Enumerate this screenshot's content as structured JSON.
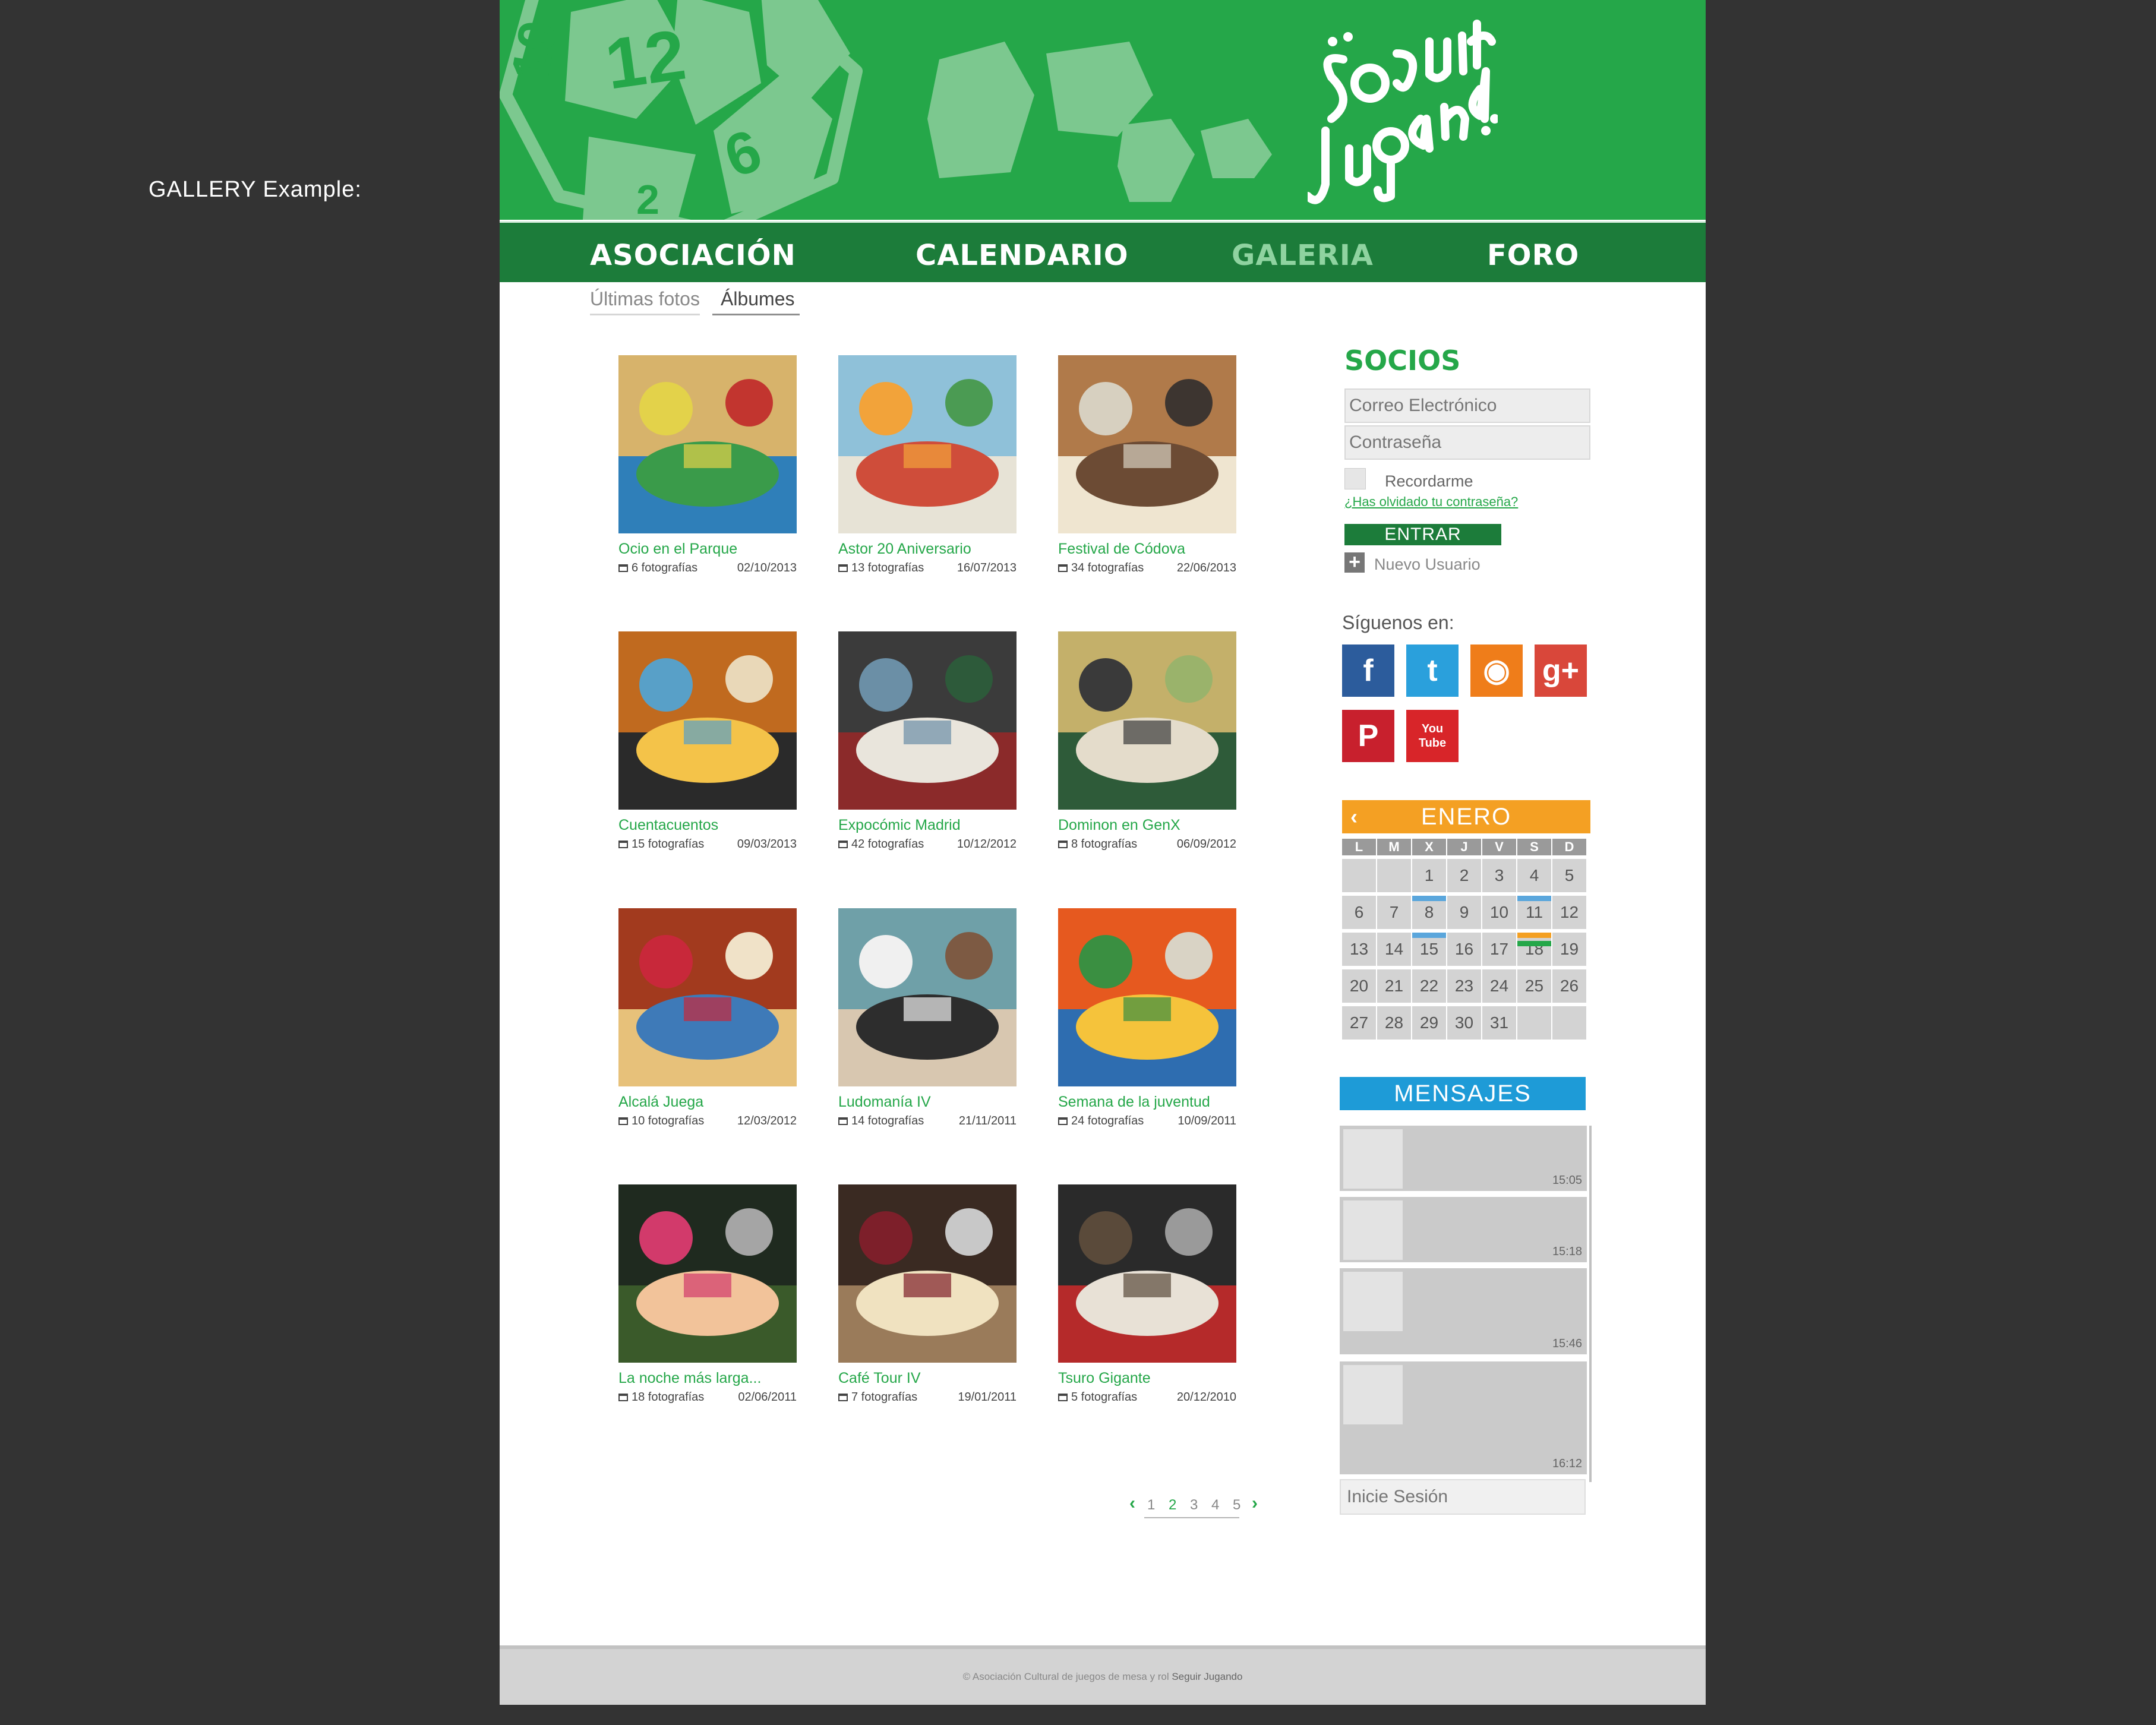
{
  "side_label": "GALLERY Example:",
  "header": {
    "logo_top": "Seguir",
    "logo_bottom": "Jugando"
  },
  "nav": [
    {
      "label": "ASOCIACIÓN",
      "active": false
    },
    {
      "label": "CALENDARIO",
      "active": false
    },
    {
      "label": "GALERIA",
      "active": true
    },
    {
      "label": "FORO",
      "active": false
    }
  ],
  "subtabs": [
    {
      "label": "Últimas fotos",
      "active": false
    },
    {
      "label": "Álbumes",
      "active": true
    }
  ],
  "albums": [
    {
      "title": "Ocio en el Parque",
      "count": "6 fotografías",
      "date": "02/10/2013"
    },
    {
      "title": "Astor 20 Aniversario",
      "count": "13 fotografías",
      "date": "16/07/2013"
    },
    {
      "title": "Festival de Códova",
      "count": "34 fotografías",
      "date": "22/06/2013"
    },
    {
      "title": "Cuentacuentos",
      "count": "15 fotografías",
      "date": "09/03/2013"
    },
    {
      "title": "Expocómic Madrid",
      "count": "42 fotografías",
      "date": "10/12/2012"
    },
    {
      "title": "Dominon en GenX",
      "count": "8 fotografías",
      "date": "06/09/2012"
    },
    {
      "title": "Alcalá Juega",
      "count": "10 fotografías",
      "date": "12/03/2012"
    },
    {
      "title": "Ludomanía IV",
      "count": "14 fotografías",
      "date": "21/11/2011"
    },
    {
      "title": "Semana de la juventud",
      "count": "24 fotografías",
      "date": "10/09/2011"
    },
    {
      "title": "La noche más larga...",
      "count": "18 fotografías",
      "date": "02/06/2011"
    },
    {
      "title": "Café Tour IV",
      "count": "7 fotografías",
      "date": "19/01/2011"
    },
    {
      "title": "Tsuro Gigante",
      "count": "5 fotografías",
      "date": "20/12/2010"
    }
  ],
  "pagination": {
    "pages": [
      "1",
      "2",
      "3",
      "4",
      "5"
    ],
    "current": "2",
    "prev": "‹",
    "next": "›"
  },
  "socios": {
    "title": "SOCIOS",
    "email_placeholder": "Correo Electrónico",
    "password_placeholder": "Contraseña",
    "remember_label": "Recordarme",
    "forgot_link": "¿Has olvidado tu contraseña?",
    "submit_label": "ENTRAR",
    "new_user_label": "Nuevo Usuario"
  },
  "follow": {
    "title": "Síguenos en:",
    "networks": [
      {
        "name": "facebook",
        "glyph": "f",
        "color": "#2c5c9c"
      },
      {
        "name": "twitter",
        "glyph": "t",
        "color": "#2aa0dc"
      },
      {
        "name": "rss",
        "glyph": "◉",
        "color": "#ef7d1a"
      },
      {
        "name": "google-plus",
        "glyph": "g+",
        "color": "#d9473a"
      },
      {
        "name": "pinterest",
        "glyph": "P",
        "color": "#c8202d"
      },
      {
        "name": "youtube",
        "glyph": "You Tube",
        "color": "#d82529"
      }
    ]
  },
  "calendar": {
    "month": "ENERO",
    "weekdays": [
      "L",
      "M",
      "X",
      "J",
      "V",
      "S",
      "D"
    ],
    "weeks": [
      [
        "",
        "",
        "1",
        "2",
        "3",
        "4",
        "5"
      ],
      [
        "6",
        "7",
        "8",
        "9",
        "10",
        "11",
        "12"
      ],
      [
        "13",
        "14",
        "15",
        "16",
        "17",
        "18",
        "19"
      ],
      [
        "20",
        "21",
        "22",
        "23",
        "24",
        "25",
        "26"
      ],
      [
        "27",
        "28",
        "29",
        "30",
        "31",
        "",
        ""
      ]
    ],
    "tag_colors": {
      "blue": "#5aa6dc",
      "orange": "#f4a023",
      "green": "#25a749"
    }
  },
  "mensajes": {
    "title": "MENSAJES",
    "messages": [
      {
        "time": "15:05"
      },
      {
        "time": "15:18"
      },
      {
        "time": "15:46"
      },
      {
        "time": "16:12"
      }
    ],
    "login_placeholder": "Inicie Sesión"
  },
  "footer": {
    "text": "© Asociación Cultural de juegos de mesa y rol",
    "brand": "Seguir Jugando"
  },
  "colors": {
    "brand_green": "#25a749",
    "dark_green": "#1c7c3a",
    "orange": "#f4a023",
    "blue": "#1e9bd7"
  }
}
